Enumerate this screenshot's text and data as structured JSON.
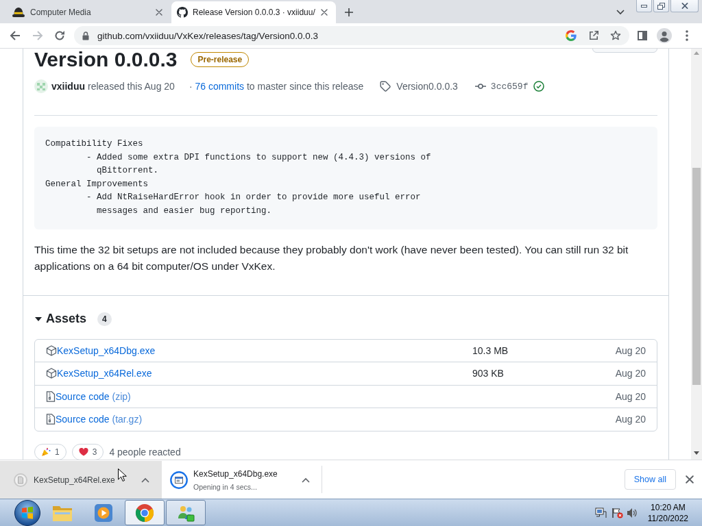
{
  "browser": {
    "tabs": [
      {
        "title": "Computer Media",
        "selected": false
      },
      {
        "title": "Release Version 0.0.0.3 · vxiiduu/",
        "selected": true
      }
    ],
    "navigation": {
      "back_enabled": true,
      "forward_enabled": false
    },
    "address": "github.com/vxiiduu/VxKex/releases/tag/Version0.0.0.3"
  },
  "release": {
    "title": "Version 0.0.0.3",
    "badge": "Pre-release",
    "author": "vxiiduu",
    "released": "released this Aug 20",
    "commits": {
      "prefix": "·",
      "link": "76 commits",
      "suffix": "to master since this release"
    },
    "tag": "Version0.0.0.3",
    "commit": "3cc659f",
    "verified": true,
    "notes": [
      "Compatibility Fixes",
      "\t- Added some extra DPI functions to support new (4.4.3) versions of",
      "\t  qBittorrent.",
      "General Improvements",
      "\t- Add NtRaiseHardError hook in order to provide more useful error",
      "\t  messages and easier bug reporting."
    ],
    "description": "This time the 32 bit setups are not included because they probably don't work (have never been tested). You can still run 32 bit applications on a 64 bit computer/OS under VxKex."
  },
  "assets": {
    "title": "Assets",
    "count": "4",
    "expanded": true,
    "items": [
      {
        "kind": "package",
        "name": "KexSetup_x64Dbg.exe",
        "size": "10.3 MB",
        "date": "Aug 20"
      },
      {
        "kind": "package",
        "name": "KexSetup_x64Rel.exe",
        "size": "903 KB",
        "date": "Aug 20"
      },
      {
        "kind": "source",
        "name": "Source code",
        "suffix": "(zip)",
        "date": "Aug 20"
      },
      {
        "kind": "source",
        "name": "Source code",
        "suffix": "(tar.gz)",
        "date": "Aug 20"
      }
    ]
  },
  "reactions": {
    "items": [
      {
        "kind": "tada",
        "count": "1",
        "selected": false
      },
      {
        "kind": "heart",
        "count": "3",
        "selected": false
      }
    ],
    "summary": "4 people reacted"
  },
  "downloads": {
    "items": [
      {
        "name": "KexSetup_x64Rel.exe",
        "opening": false,
        "hovered": true
      },
      {
        "name": "KexSetup_x64Dbg.exe",
        "status": "Opening in 4 secs...",
        "opening": true,
        "hovered": false
      }
    ],
    "show_all": "Show all"
  },
  "taskbar": {
    "apps": [
      {
        "kind": "folder",
        "running": false,
        "active": false
      },
      {
        "kind": "media",
        "running": false,
        "active": false
      },
      {
        "kind": "browser",
        "running": true,
        "active": true
      },
      {
        "kind": "people",
        "running": true,
        "active": false
      }
    ],
    "clock": {
      "time": "10:20 AM",
      "date": "11/20/2022"
    }
  }
}
